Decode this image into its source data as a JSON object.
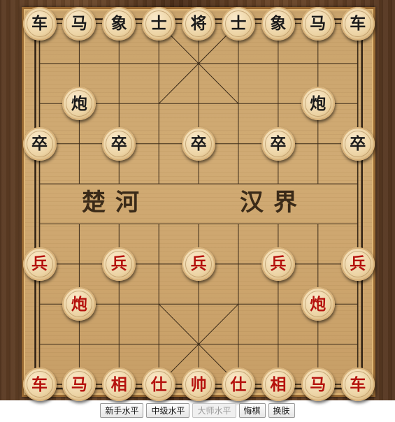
{
  "board": {
    "river_left": "楚河",
    "river_right": "汉界"
  },
  "pieces": {
    "black": [
      {
        "label": "车",
        "col": 0,
        "row": 0
      },
      {
        "label": "马",
        "col": 1,
        "row": 0
      },
      {
        "label": "象",
        "col": 2,
        "row": 0
      },
      {
        "label": "士",
        "col": 3,
        "row": 0
      },
      {
        "label": "将",
        "col": 4,
        "row": 0
      },
      {
        "label": "士",
        "col": 5,
        "row": 0
      },
      {
        "label": "象",
        "col": 6,
        "row": 0
      },
      {
        "label": "马",
        "col": 7,
        "row": 0
      },
      {
        "label": "车",
        "col": 8,
        "row": 0
      },
      {
        "label": "炮",
        "col": 1,
        "row": 2
      },
      {
        "label": "炮",
        "col": 7,
        "row": 2
      },
      {
        "label": "卒",
        "col": 0,
        "row": 3
      },
      {
        "label": "卒",
        "col": 2,
        "row": 3
      },
      {
        "label": "卒",
        "col": 4,
        "row": 3
      },
      {
        "label": "卒",
        "col": 6,
        "row": 3
      },
      {
        "label": "卒",
        "col": 8,
        "row": 3
      }
    ],
    "red": [
      {
        "label": "兵",
        "col": 0,
        "row": 6
      },
      {
        "label": "兵",
        "col": 2,
        "row": 6
      },
      {
        "label": "兵",
        "col": 4,
        "row": 6
      },
      {
        "label": "兵",
        "col": 6,
        "row": 6
      },
      {
        "label": "兵",
        "col": 8,
        "row": 6
      },
      {
        "label": "炮",
        "col": 1,
        "row": 7
      },
      {
        "label": "炮",
        "col": 7,
        "row": 7
      },
      {
        "label": "车",
        "col": 0,
        "row": 9
      },
      {
        "label": "马",
        "col": 1,
        "row": 9
      },
      {
        "label": "相",
        "col": 2,
        "row": 9
      },
      {
        "label": "仕",
        "col": 3,
        "row": 9
      },
      {
        "label": "帅",
        "col": 4,
        "row": 9
      },
      {
        "label": "仕",
        "col": 5,
        "row": 9
      },
      {
        "label": "相",
        "col": 6,
        "row": 9
      },
      {
        "label": "马",
        "col": 7,
        "row": 9
      },
      {
        "label": "车",
        "col": 8,
        "row": 9
      }
    ]
  },
  "controls": {
    "novice_label": "新手水平",
    "intermediate_label": "中级水平",
    "master_label": "大师水平",
    "undo_label": "悔棋",
    "skin_label": "换肤"
  }
}
